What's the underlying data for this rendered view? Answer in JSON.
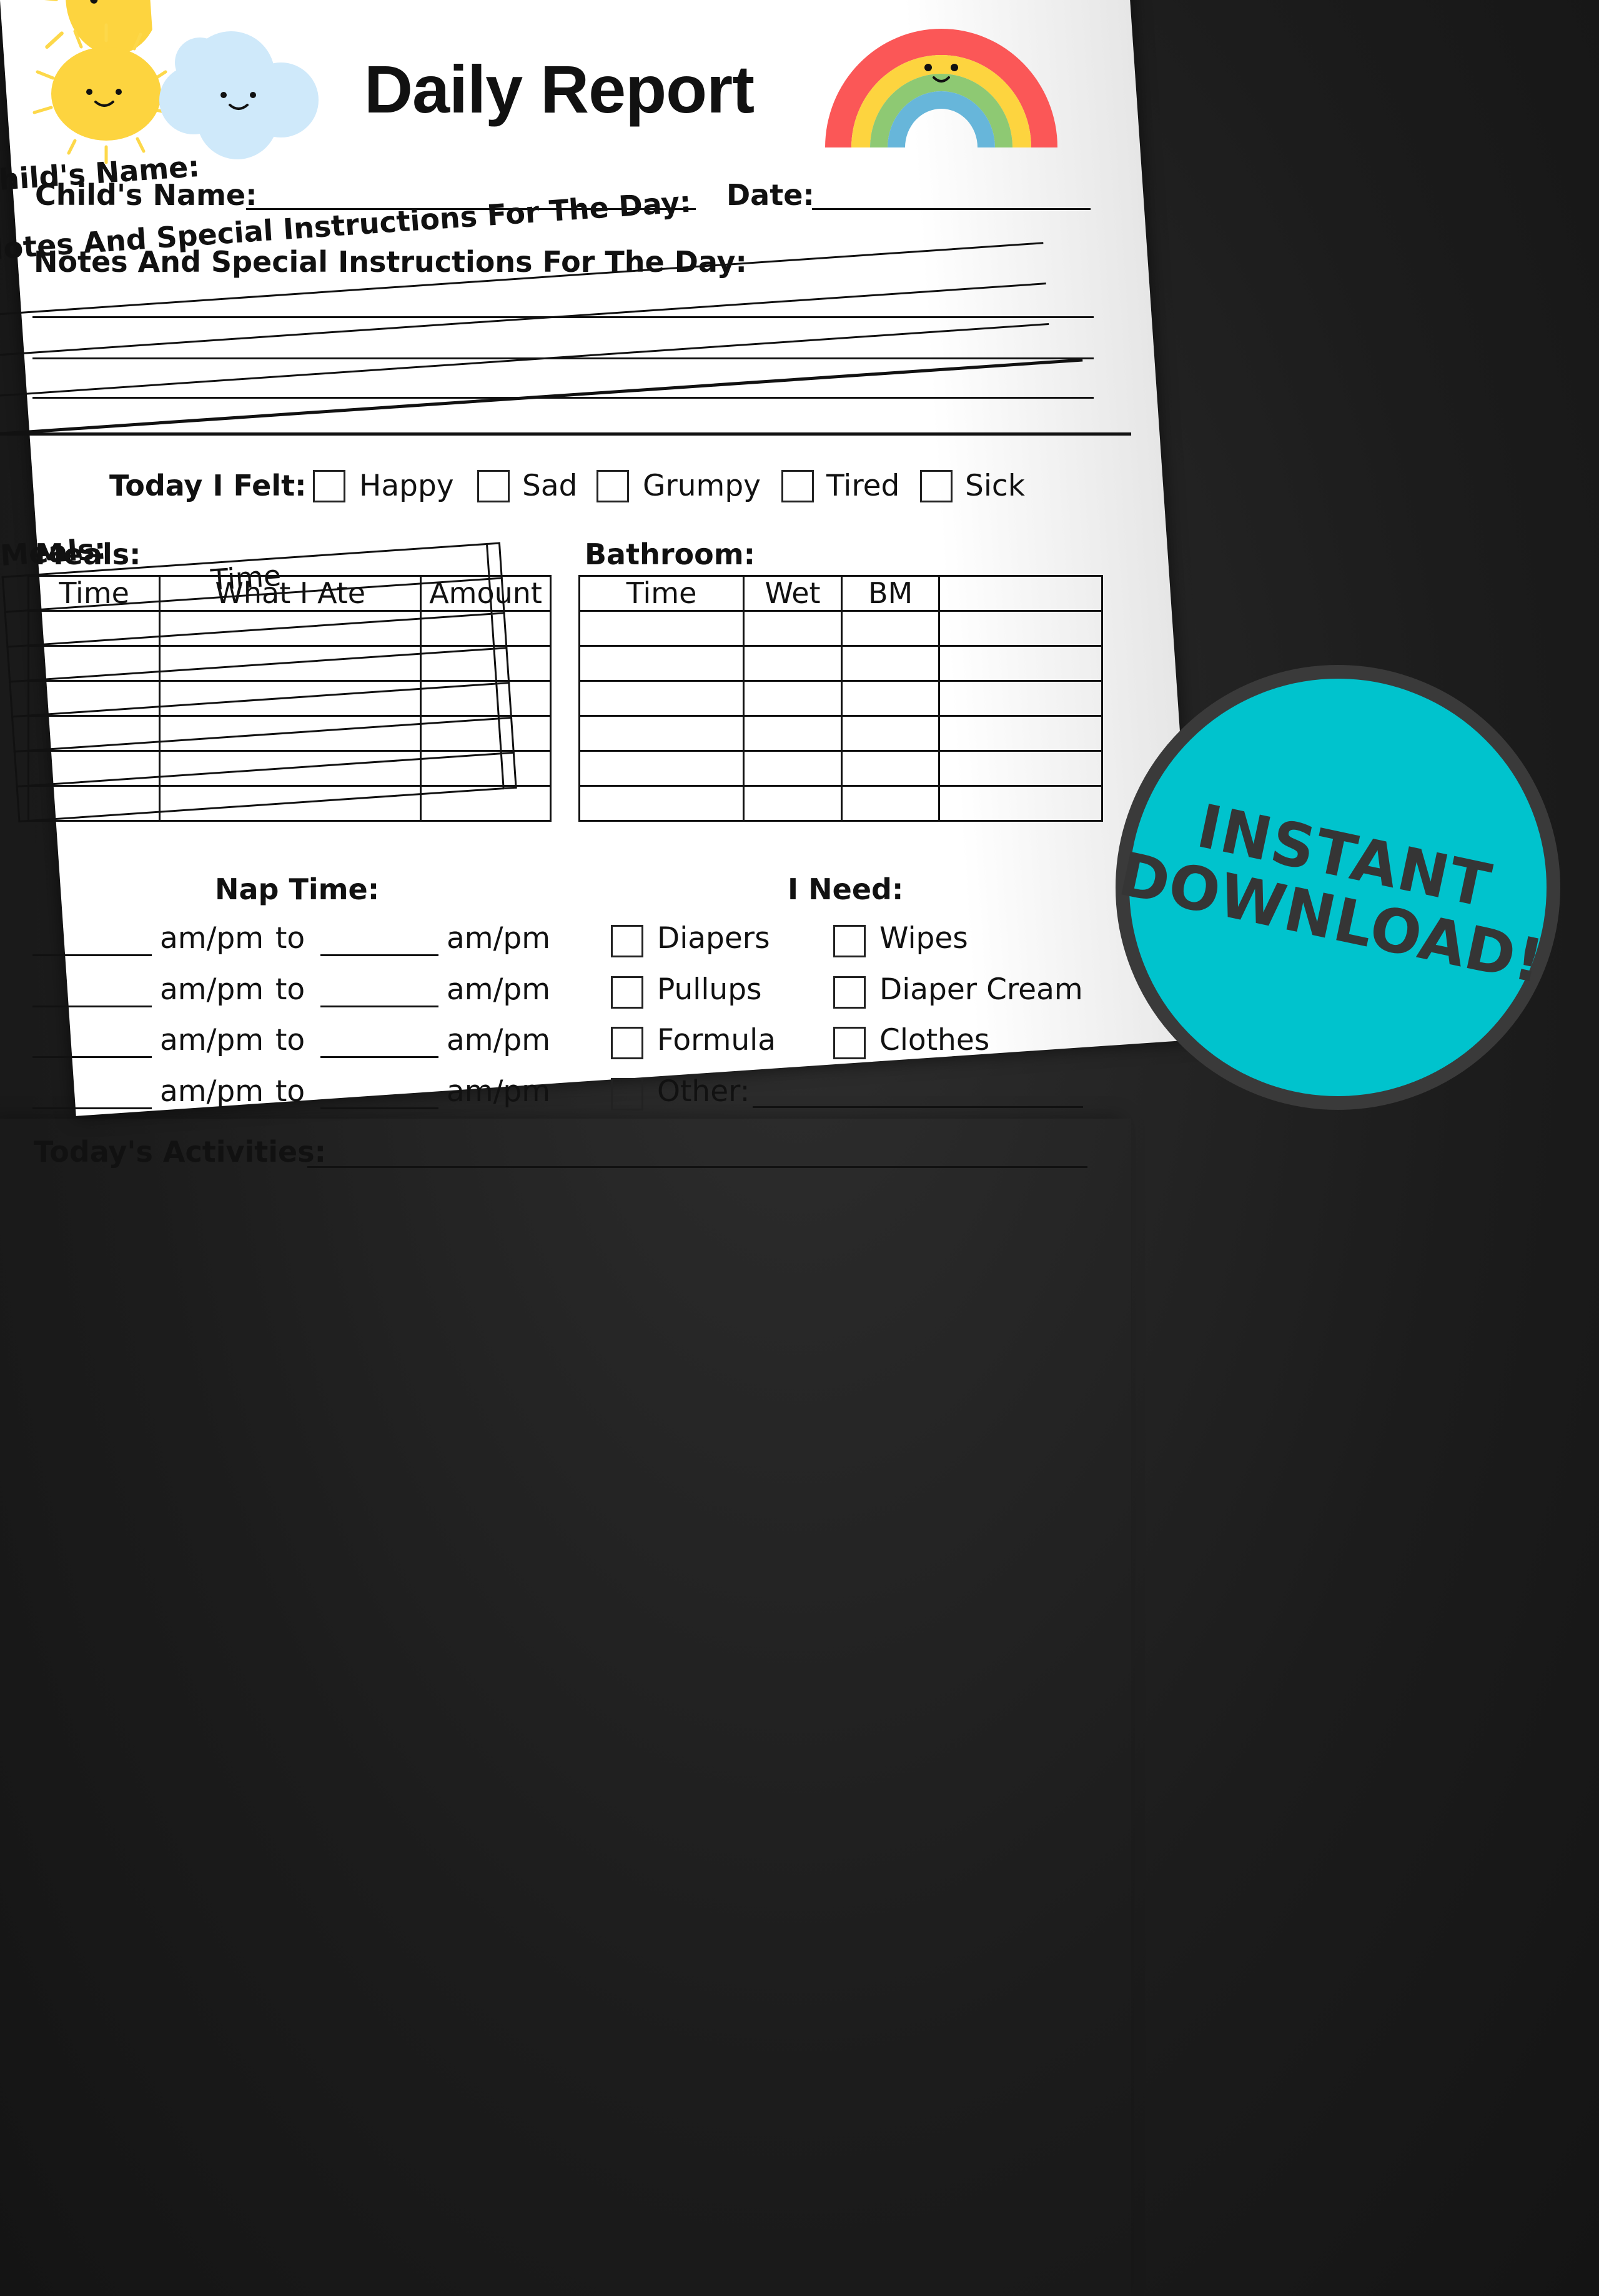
{
  "back_sheet": {
    "childs_name_label": "Child's Name:",
    "notes_label": "Notes And Special Instructions For The Day:",
    "meals_label": "Meals:",
    "meals_time_header": "Time"
  },
  "header": {
    "title": "Daily Report",
    "illustrations": [
      "sun-icon",
      "cloud-icon",
      "rainbow-icon"
    ]
  },
  "fields": {
    "childs_name_label": "Child's Name:",
    "date_label": "Date:",
    "notes_label": "Notes And Special Instructions For The Day:"
  },
  "feelings": {
    "label": "Today I Felt:",
    "options": [
      "Happy",
      "Sad",
      "Grumpy",
      "Tired",
      "Sick"
    ]
  },
  "meals": {
    "label": "Meals:",
    "columns": [
      "Time",
      "What I Ate",
      "Amount"
    ]
  },
  "bathroom": {
    "label": "Bathroom:",
    "columns": [
      "Time",
      "Wet",
      "BM"
    ]
  },
  "nap": {
    "label": "Nap Time:",
    "ampm": "am/pm",
    "to": "to"
  },
  "needs": {
    "label": "I Need:",
    "col1": [
      "Diapers",
      "Pullups",
      "Formula",
      "Other:"
    ],
    "col2": [
      "Wipes",
      "Diaper Cream",
      "Clothes"
    ]
  },
  "activities": {
    "label": "Today's Activities:"
  },
  "badge": {
    "line1": "INSTANT",
    "line2": "DOWNLOAD!",
    "fill_color": "#00c3cd",
    "border_color": "#3a3a3a"
  }
}
